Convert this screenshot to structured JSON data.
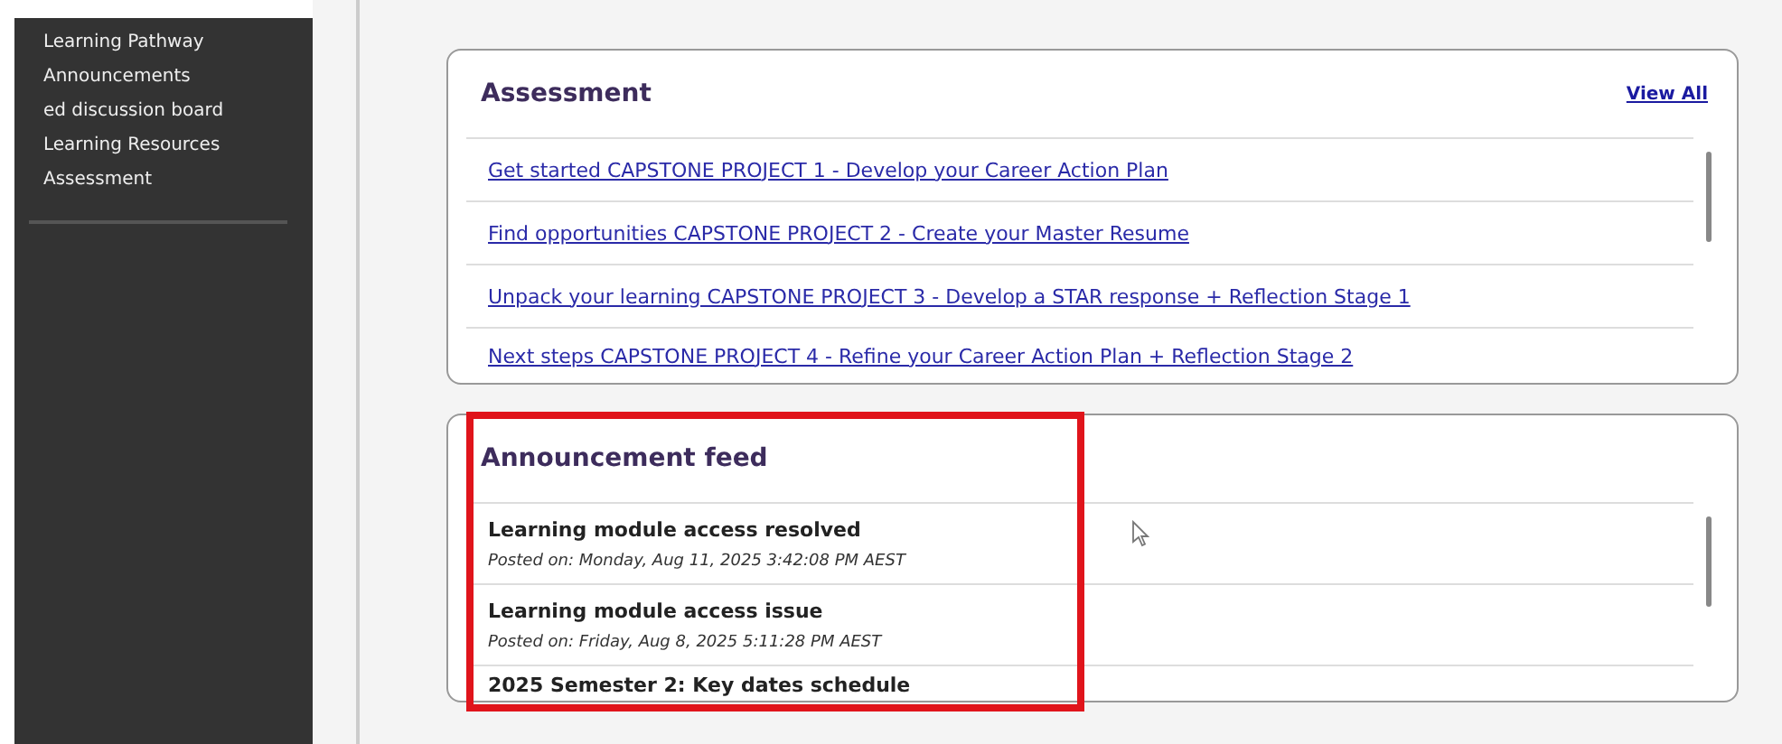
{
  "sidebar": {
    "items": [
      {
        "label": "Learning Pathway"
      },
      {
        "label": "Announcements"
      },
      {
        "label": "ed discussion board"
      },
      {
        "label": "Learning Resources"
      },
      {
        "label": "Assessment"
      }
    ]
  },
  "assessment": {
    "title": "Assessment",
    "view_all": "View All",
    "items": [
      {
        "label": "Get started CAPSTONE PROJECT 1 - Develop your Career Action Plan"
      },
      {
        "label": "Find opportunities CAPSTONE PROJECT 2 - Create your Master Resume"
      },
      {
        "label": "Unpack your learning CAPSTONE PROJECT 3 - Develop a STAR response + Reflection Stage 1"
      },
      {
        "label": "Next steps CAPSTONE PROJECT 4 - Refine your Career Action Plan + Reflection Stage 2"
      }
    ]
  },
  "announcements": {
    "title": "Announcement feed",
    "items": [
      {
        "title": "Learning module access resolved",
        "posted": "Posted on: Monday, Aug 11, 2025 3:42:08 PM AEST"
      },
      {
        "title": "Learning module access issue",
        "posted": "Posted on: Friday, Aug 8, 2025 5:11:28 PM AEST"
      },
      {
        "title": "2025 Semester 2: Key dates schedule"
      }
    ]
  }
}
